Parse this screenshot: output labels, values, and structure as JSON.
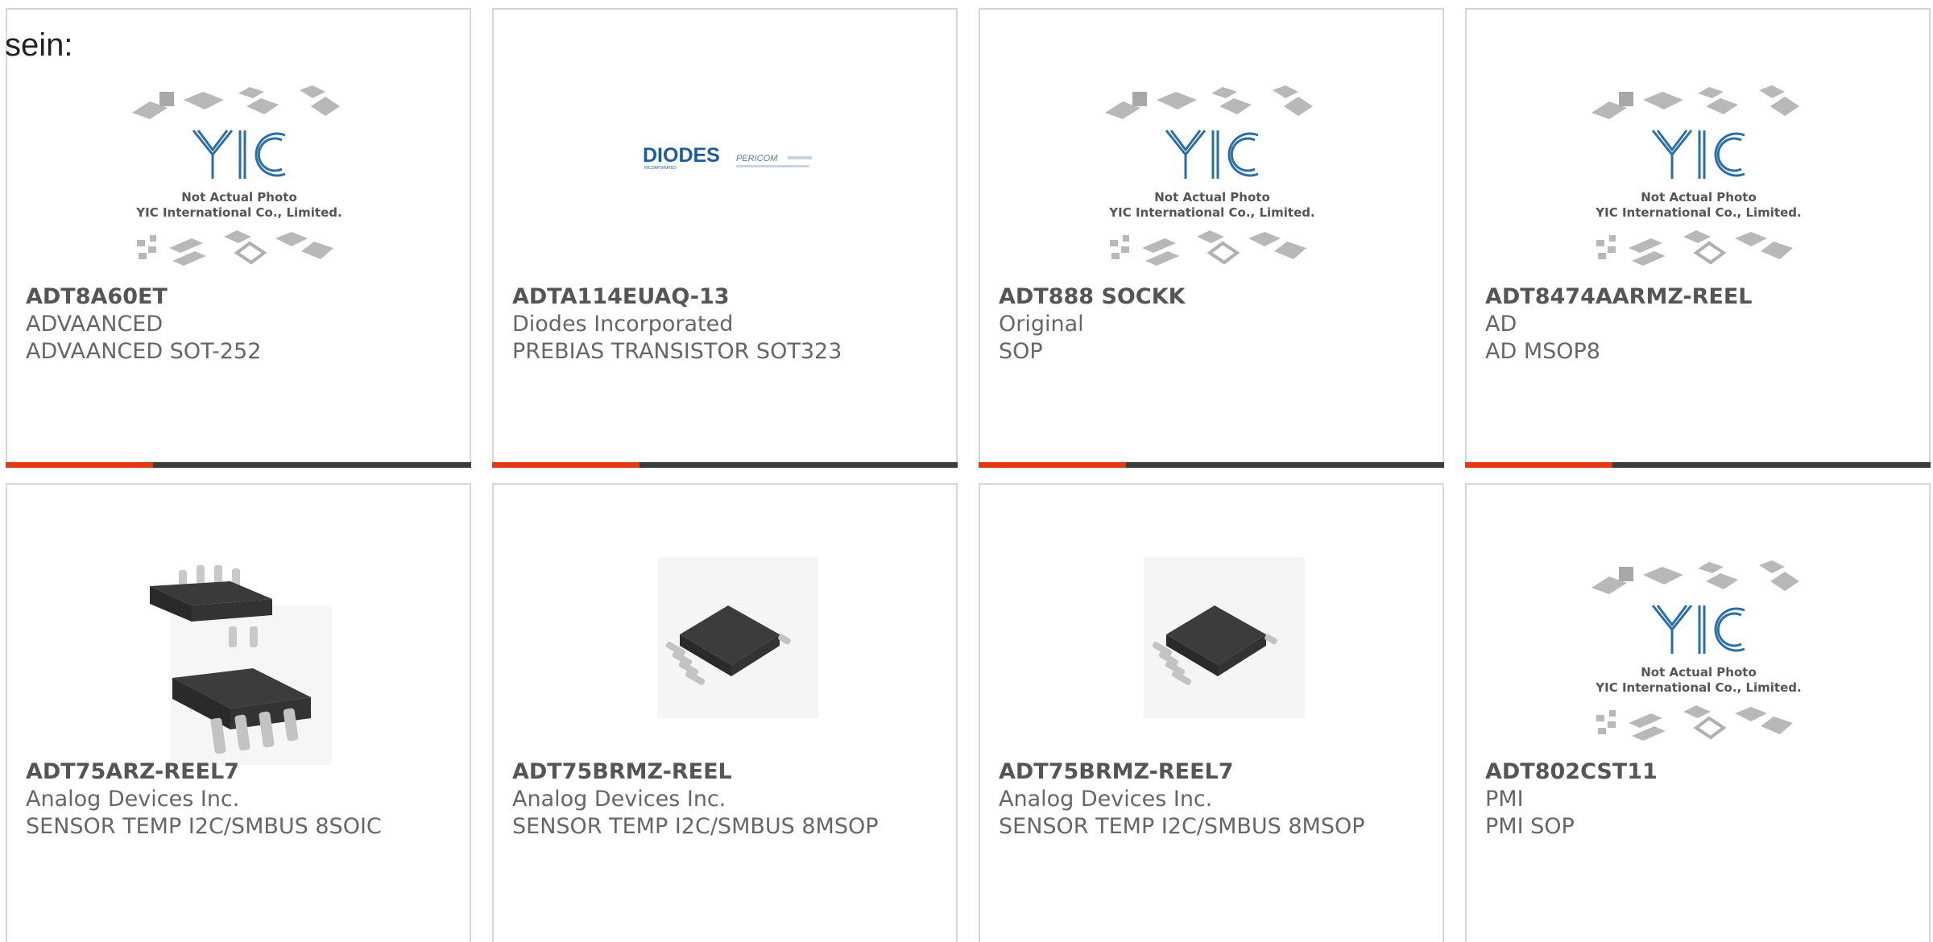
{
  "lead_text": "sein:",
  "colors": {
    "accent": "#e03a12",
    "bar": "#3b3b3b",
    "border": "#d6d6d6"
  },
  "placeholder_photo": {
    "brand": "YIC",
    "line1": "Not Actual Photo",
    "line2": "YIC International Co., Limited."
  },
  "diodes_logo": {
    "brand": "DIODES",
    "sub": "INCORPORATED",
    "partner": "PERICOM"
  },
  "cards": [
    {
      "part": "ADT8A60ET",
      "maker": "ADVAANCED",
      "desc": "ADVAANCED SOT-252",
      "image": "yic-placeholder-icon"
    },
    {
      "part": "ADTA114EUAQ-13",
      "maker": "Diodes Incorporated",
      "desc": "PREBIAS TRANSISTOR SOT323",
      "image": "diodes-logo"
    },
    {
      "part": "ADT888 SOCKK",
      "maker": "Original",
      "desc": "SOP",
      "image": "yic-placeholder-icon"
    },
    {
      "part": "ADT8474AARMZ-REEL",
      "maker": "AD",
      "desc": "AD MSOP8",
      "image": "yic-placeholder-icon"
    },
    {
      "part": "ADT75ARZ-REEL7",
      "maker": "Analog Devices Inc.",
      "desc": "SENSOR TEMP I2C/SMBUS 8SOIC",
      "image": "soic8-chip-icon"
    },
    {
      "part": "ADT75BRMZ-REEL",
      "maker": "Analog Devices Inc.",
      "desc": "SENSOR TEMP I2C/SMBUS 8MSOP",
      "image": "msop8-chip-icon"
    },
    {
      "part": "ADT75BRMZ-REEL7",
      "maker": "Analog Devices Inc.",
      "desc": "SENSOR TEMP I2C/SMBUS 8MSOP",
      "image": "msop8-chip-icon"
    },
    {
      "part": "ADT802CST11",
      "maker": "PMI",
      "desc": "PMI SOP",
      "image": "yic-placeholder-icon"
    }
  ]
}
